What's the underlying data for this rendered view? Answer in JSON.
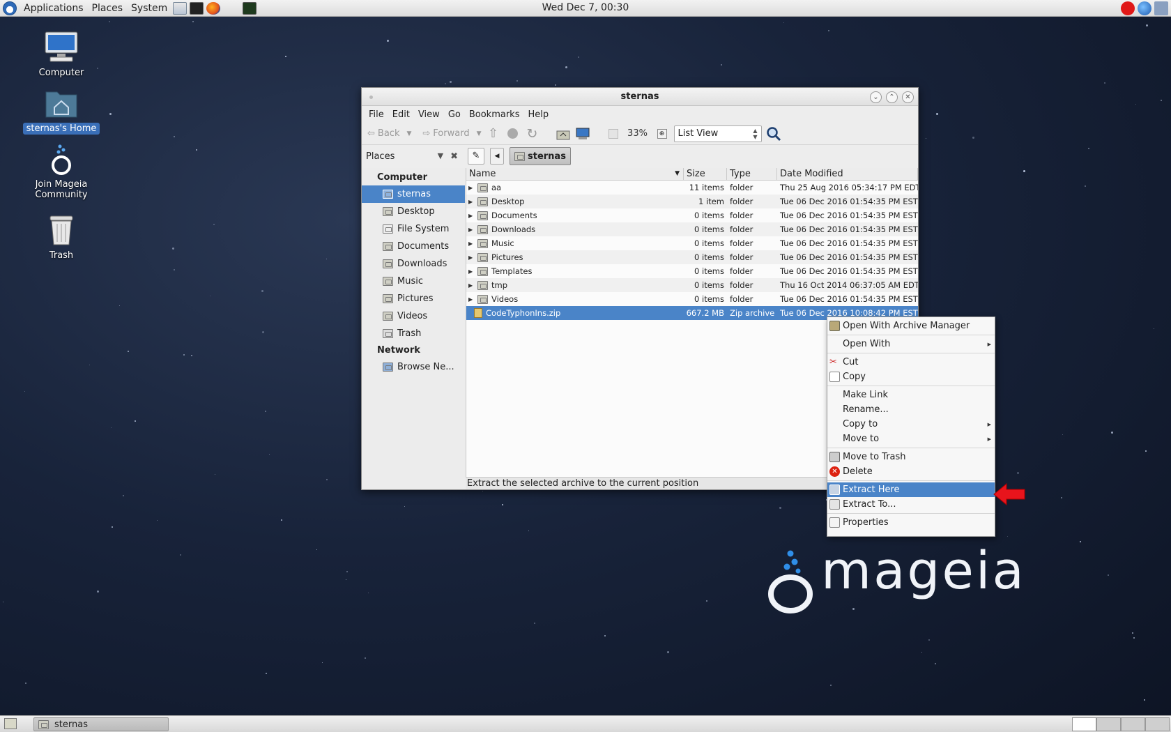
{
  "top_panel": {
    "menus": [
      "Applications",
      "Places",
      "System"
    ],
    "clock": "Wed Dec  7, 00:30"
  },
  "desktop_icons": [
    {
      "label": "Computer",
      "icon": "computer-icon"
    },
    {
      "label": "sternas's Home",
      "icon": "home-folder-icon",
      "selected": true
    },
    {
      "label": "Join Mageia Community",
      "icon": "mageia-community-icon"
    },
    {
      "label": "Trash",
      "icon": "trash-icon"
    }
  ],
  "window": {
    "title": "sternas",
    "menubar": [
      "File",
      "Edit",
      "View",
      "Go",
      "Bookmarks",
      "Help"
    ],
    "toolbar": {
      "back": "Back",
      "forward": "Forward",
      "zoom": "33%",
      "view_mode": "List View"
    },
    "places_label": "Places",
    "location": "sternas",
    "sidebar": {
      "computer_header": "Computer",
      "items": [
        "sternas",
        "Desktop",
        "File System",
        "Documents",
        "Downloads",
        "Music",
        "Pictures",
        "Videos",
        "Trash"
      ],
      "network_header": "Network",
      "network_items": [
        "Browse Ne..."
      ]
    },
    "columns": {
      "name": "Name",
      "size": "Size",
      "type": "Type",
      "date": "Date Modified"
    },
    "files": [
      {
        "name": "aa",
        "size": "11 items",
        "type": "folder",
        "date": "Thu 25 Aug 2016 05:34:17 PM EDT"
      },
      {
        "name": "Desktop",
        "size": "1 item",
        "type": "folder",
        "date": "Tue 06 Dec 2016 01:54:35 PM EST"
      },
      {
        "name": "Documents",
        "size": "0 items",
        "type": "folder",
        "date": "Tue 06 Dec 2016 01:54:35 PM EST"
      },
      {
        "name": "Downloads",
        "size": "0 items",
        "type": "folder",
        "date": "Tue 06 Dec 2016 01:54:35 PM EST"
      },
      {
        "name": "Music",
        "size": "0 items",
        "type": "folder",
        "date": "Tue 06 Dec 2016 01:54:35 PM EST"
      },
      {
        "name": "Pictures",
        "size": "0 items",
        "type": "folder",
        "date": "Tue 06 Dec 2016 01:54:35 PM EST"
      },
      {
        "name": "Templates",
        "size": "0 items",
        "type": "folder",
        "date": "Tue 06 Dec 2016 01:54:35 PM EST"
      },
      {
        "name": "tmp",
        "size": "0 items",
        "type": "folder",
        "date": "Thu 16 Oct 2014 06:37:05 AM EDT"
      },
      {
        "name": "Videos",
        "size": "0 items",
        "type": "folder",
        "date": "Tue 06 Dec 2016 01:54:35 PM EST"
      },
      {
        "name": "CodeTyphonIns.zip",
        "size": "667.2 MB",
        "type": "Zip archive",
        "date": "Tue 06 Dec 2016 10:08:42 PM EST"
      }
    ],
    "status": "Extract the selected archive to the current position"
  },
  "context_menu": {
    "open_archive": "Open With Archive Manager",
    "open_with": "Open With",
    "cut": "Cut",
    "copy": "Copy",
    "make_link": "Make Link",
    "rename": "Rename...",
    "copy_to": "Copy to",
    "move_to": "Move to",
    "move_to_trash": "Move to Trash",
    "delete": "Delete",
    "extract_here": "Extract Here",
    "extract_to": "Extract To...",
    "properties": "Properties"
  },
  "brand": {
    "wordmark": "mageia"
  },
  "taskbar": {
    "task": "sternas"
  },
  "colors": {
    "accent": "#4a84c8",
    "arrow": "#e8141c"
  }
}
